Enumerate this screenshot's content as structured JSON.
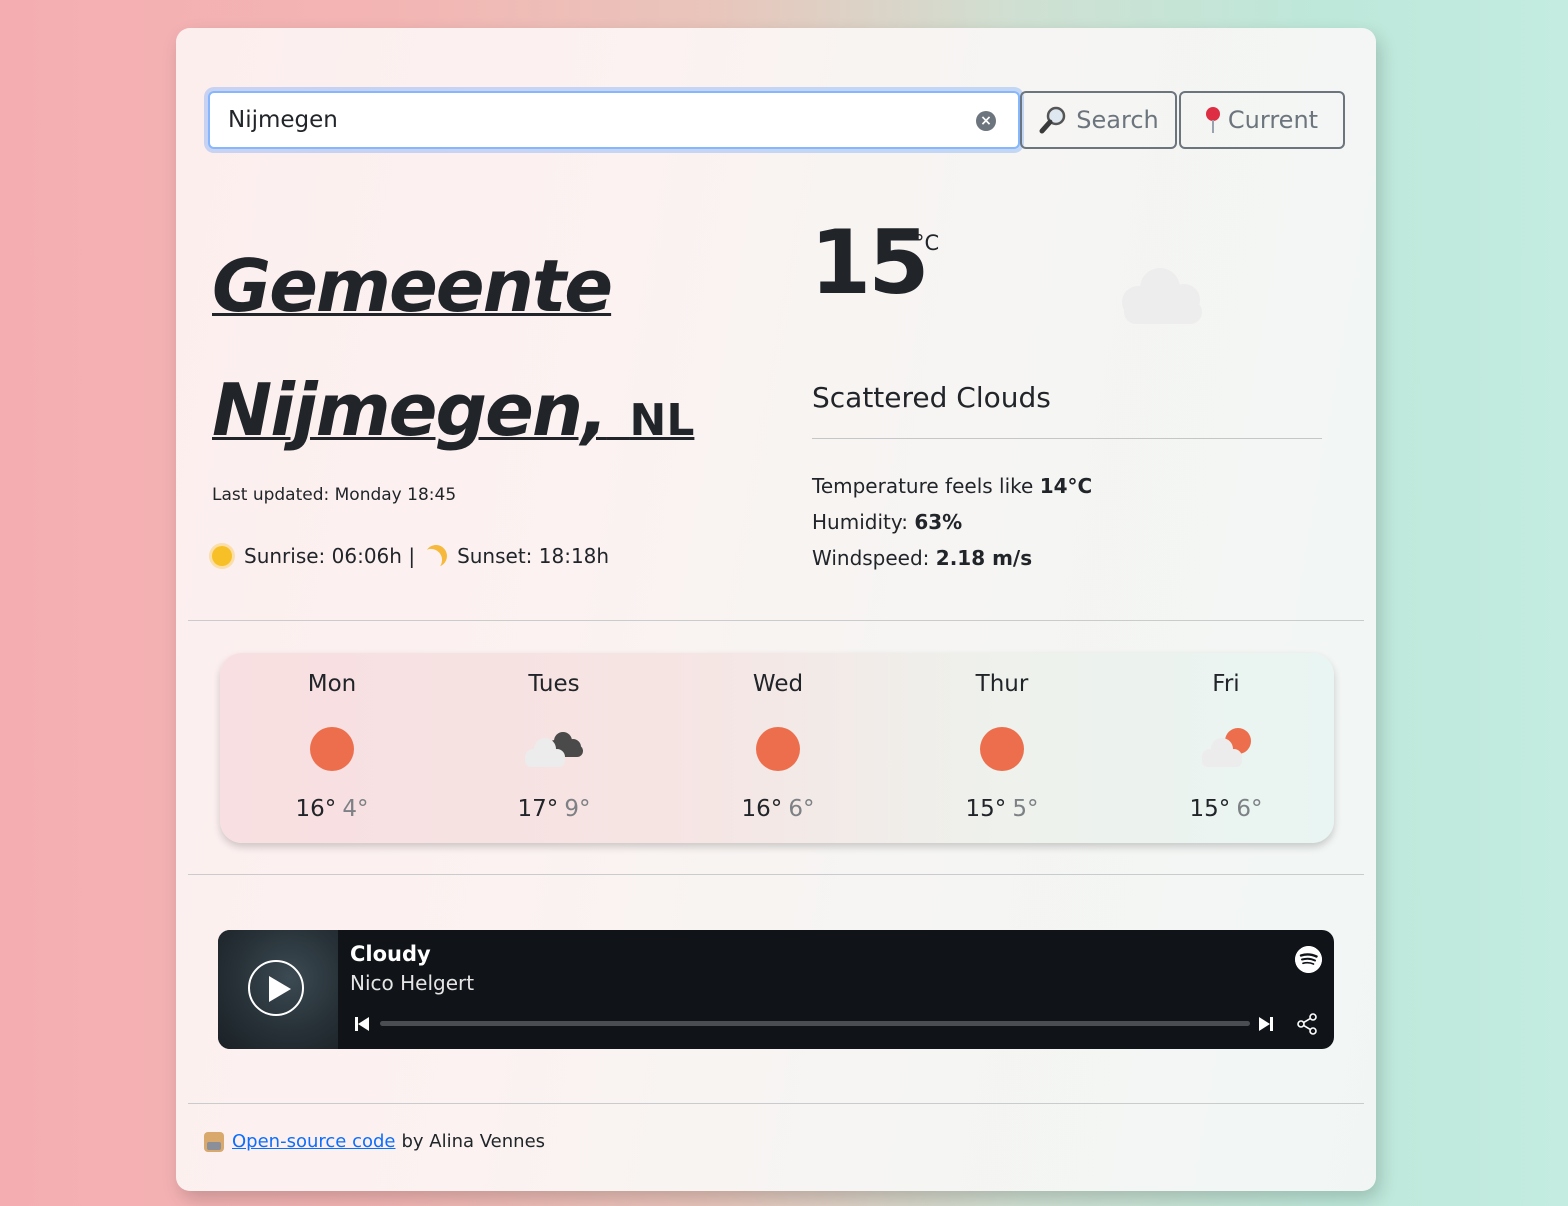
{
  "search": {
    "value": "Nijmegen",
    "search_label": "Search",
    "current_label": "Current",
    "search_icon": "magnifier-icon",
    "current_icon": "pin-icon"
  },
  "location": {
    "city": "Gemeente Nijmegen,",
    "country": "NL",
    "last_updated": "Last updated: Monday 18:45",
    "sunrise": "Sunrise: 06:06h |",
    "sunset": "Sunset: 18:18h"
  },
  "current": {
    "temperature": "15",
    "unit": "°C",
    "description": "Scattered Clouds",
    "feels_like_label": "Temperature feels like",
    "feels_like_value": "14°C",
    "humidity_label": "Humidity:",
    "humidity_value": "63%",
    "windspeed_label": "Windspeed:",
    "windspeed_value": "2.18 m/s"
  },
  "forecast": [
    {
      "day": "Mon",
      "icon": "sun-icon",
      "high": "16°",
      "low": "4°"
    },
    {
      "day": "Tues",
      "icon": "broken-clouds-icon",
      "high": "17°",
      "low": "9°"
    },
    {
      "day": "Wed",
      "icon": "sun-icon",
      "high": "16°",
      "low": "6°"
    },
    {
      "day": "Thur",
      "icon": "sun-icon",
      "high": "15°",
      "low": "5°"
    },
    {
      "day": "Fri",
      "icon": "sun-behind-cloud-icon",
      "high": "15°",
      "low": "6°"
    }
  ],
  "player": {
    "track": "Cloudy",
    "artist": "Nico Helgert"
  },
  "footer": {
    "link_text": "Open-source code",
    "suffix": "by Alina Vennes"
  },
  "colors": {
    "accent": "#0d6efd",
    "sun": "#ec6e4c",
    "player_bg": "#101418"
  }
}
